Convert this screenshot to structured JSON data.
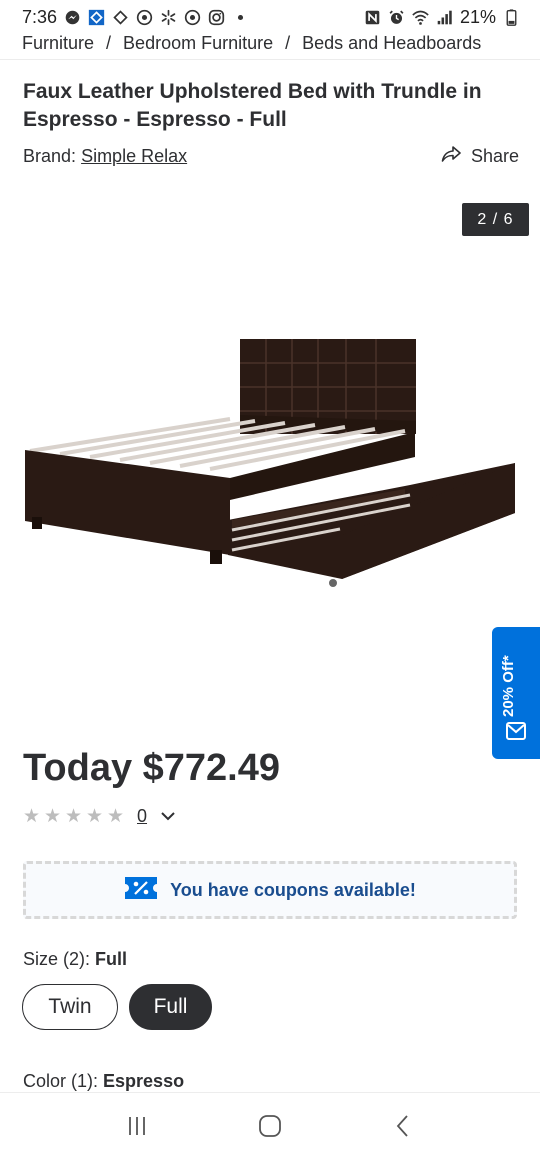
{
  "status_bar": {
    "time": "7:36",
    "battery": "21%",
    "left_icons": [
      "messenger-icon",
      "walmart-app-icon",
      "diamond-icon",
      "target-icon",
      "walmart-spark-icon",
      "target-icon-2",
      "instagram-icon",
      "dot-icon"
    ],
    "right_icons": [
      "nfc-icon",
      "alarm-icon",
      "wifi-icon",
      "signal-icon",
      "battery-icon"
    ]
  },
  "breadcrumb": {
    "items": [
      "Furniture",
      "Bedroom Furniture",
      "Beds and Headboards"
    ],
    "separator": "/"
  },
  "product": {
    "title": "Faux Leather Upholstered Bed with Trundle in Espresso - Espresso - Full",
    "brand_label": "Brand:",
    "brand_name": "Simple Relax",
    "share_label": "Share"
  },
  "gallery": {
    "counter": "2 / 6"
  },
  "promo": {
    "label": "20% Off*"
  },
  "pricing": {
    "price": "Today $772.49"
  },
  "rating": {
    "stars": 0,
    "max_stars": 5,
    "review_count": "0"
  },
  "coupon": {
    "text": "You have coupons available!"
  },
  "size": {
    "label": "Size (2):",
    "selected": "Full",
    "options": [
      "Twin",
      "Full"
    ]
  },
  "color": {
    "label": "Color (1):",
    "selected": "Espresso"
  },
  "colors": {
    "accent_blue": "#0071dc",
    "coupon_text": "#1a4d8f",
    "dark": "#2e2f32",
    "star_empty": "#bdbdbd"
  }
}
